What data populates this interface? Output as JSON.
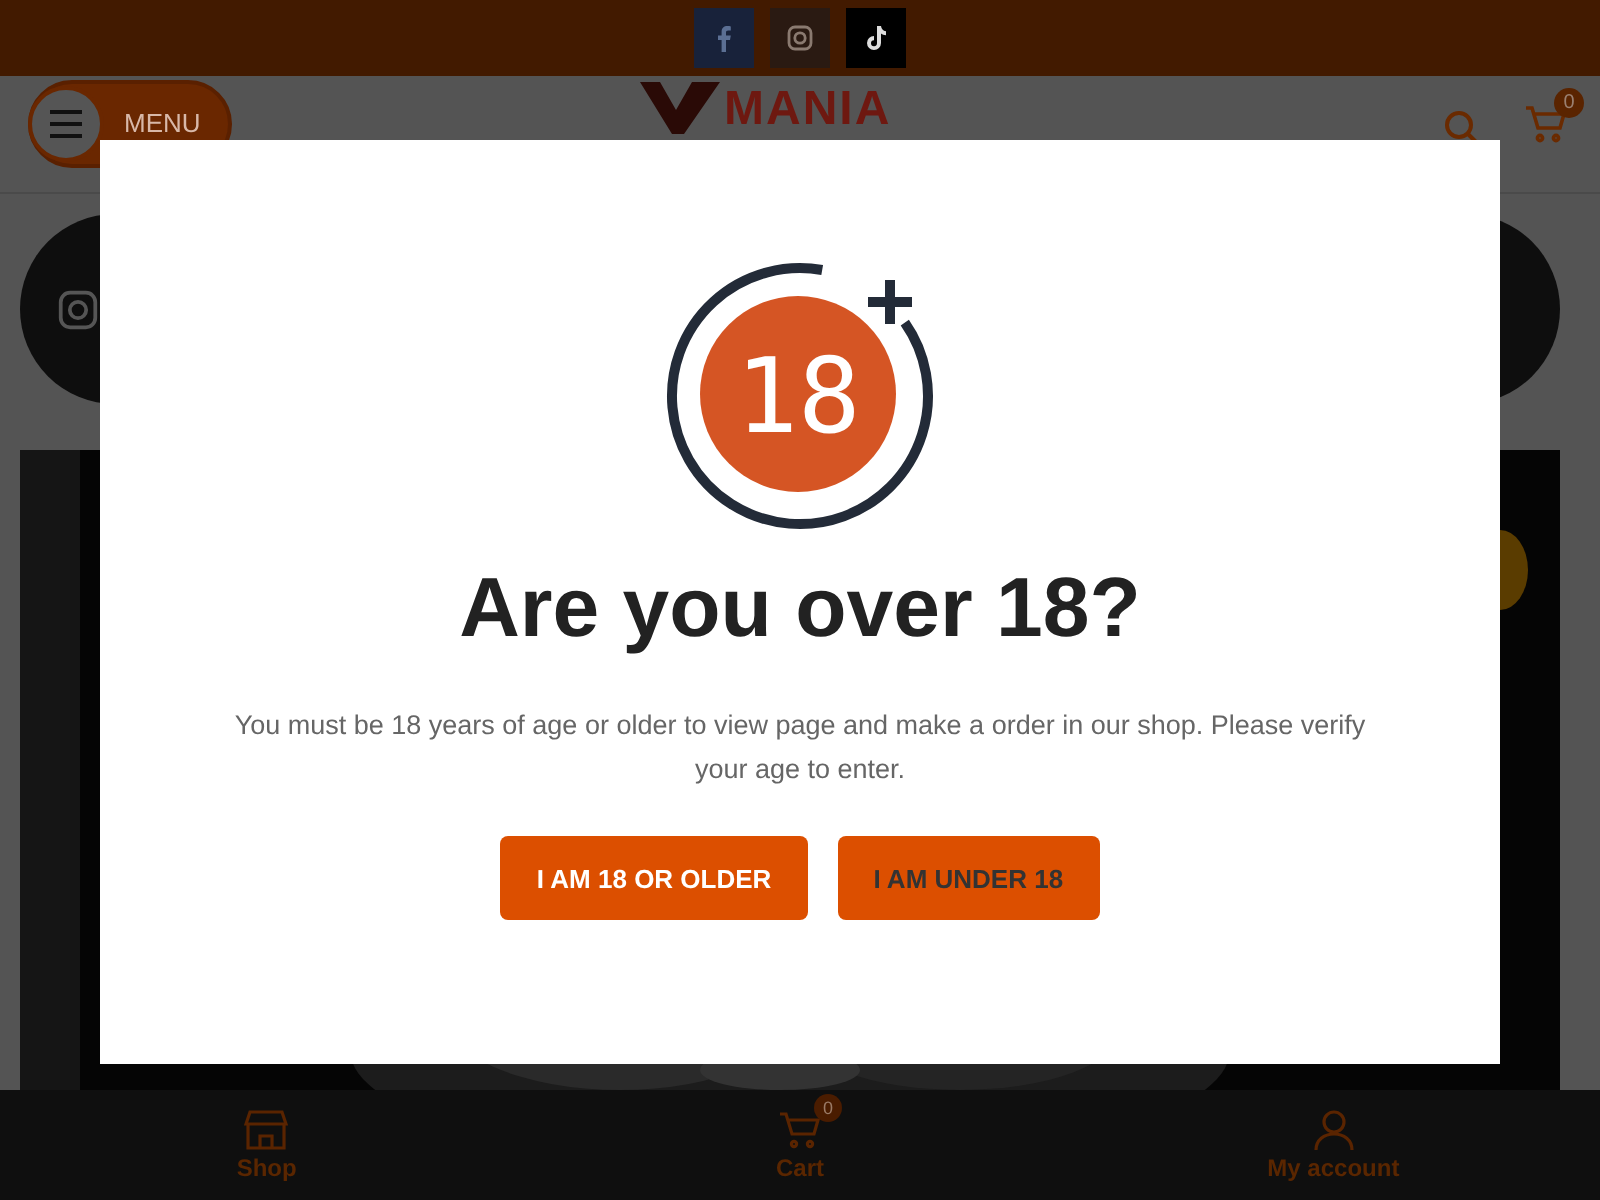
{
  "header": {
    "menu_label": "MENU",
    "logo": "MANIA",
    "cart_count": "0"
  },
  "age_gate": {
    "badge": "18",
    "title": "Are you over 18?",
    "message": "You must be 18 years of age or older to view page and make a order in our shop. Please verify your age to enter.",
    "buttons": [
      {
        "label": "I AM 18 OR OLDER",
        "kind": "confirm"
      },
      {
        "label": "I AM UNDER 18",
        "kind": "decline"
      }
    ]
  },
  "bottom_nav": [
    {
      "label": "Shop"
    },
    {
      "label": "Cart",
      "badge": "0"
    },
    {
      "label": "My account"
    }
  ]
}
